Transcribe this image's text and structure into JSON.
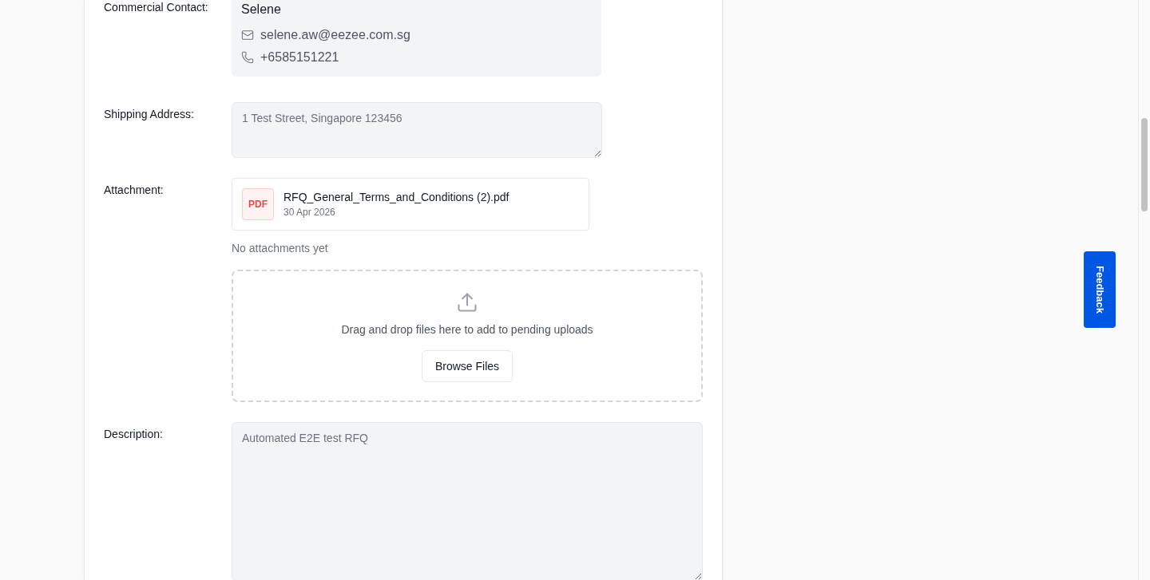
{
  "form": {
    "fields": [
      {
        "kind": "contact",
        "label": "Commercial Contact:",
        "name": "Selene",
        "email": "selene.aw@eezee.com.sg",
        "phone": "+6585151221"
      },
      {
        "kind": "textarea_small",
        "label": "Shipping Address:",
        "value": "1 Test Street, Singapore 123456",
        "disabled": true
      },
      {
        "kind": "attachments",
        "label": "Attachment:",
        "files": [
          {
            "badge": "PDF",
            "name": "RFQ_General_Terms_and_Conditions (2).pdf",
            "date": "30 Apr 2026"
          }
        ],
        "empty_note": "No attachments yet",
        "dropzone": {
          "text": "Drag and drop files here to add to pending uploads",
          "button": "Browse Files"
        }
      },
      {
        "kind": "textarea_large",
        "label": "Description:",
        "value": "Automated E2E test RFQ",
        "disabled": true
      }
    ]
  },
  "feedback_tab": {
    "label": "Feedback"
  }
}
